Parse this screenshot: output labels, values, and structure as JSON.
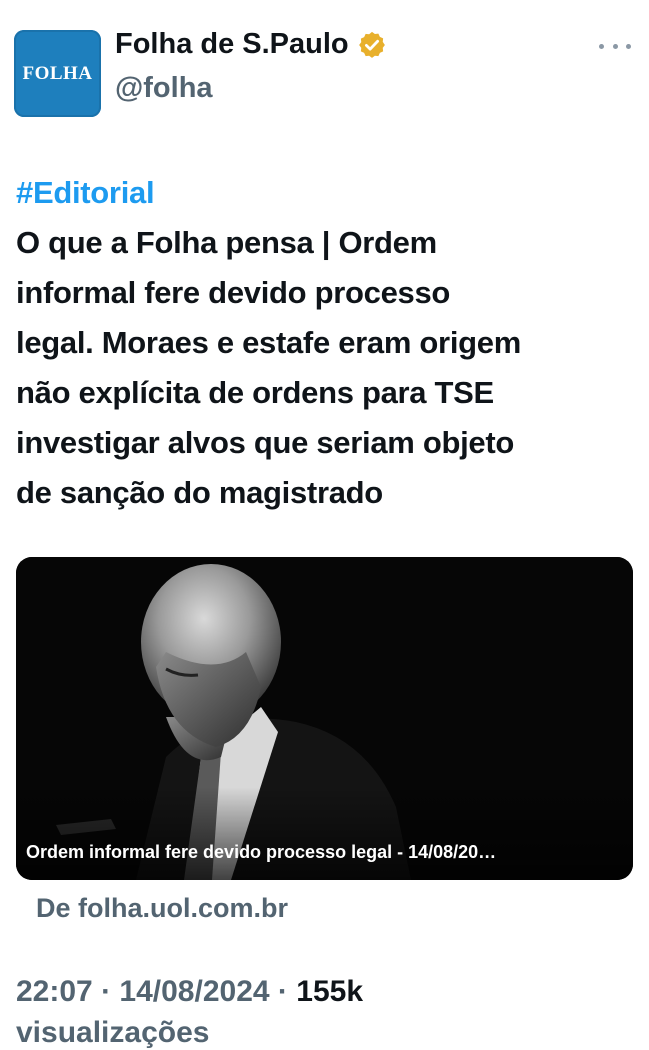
{
  "account": {
    "display_name": "Folha de S.Paulo",
    "handle": "@folha",
    "avatar_text": "FOLHA",
    "verified_badge_color": "#e8b02c",
    "avatar_color": "#1e7fbd"
  },
  "more_icon": "more-horizontal-icon",
  "tweet": {
    "hashtag": "#Editorial",
    "lines": [
      "O que a Folha pensa | Ordem",
      "informal fere devido processo",
      "legal. Moraes e estafe eram origem",
      "não explícita de ordens para TSE",
      "investigar alvos que seriam objeto",
      "de sanção do magistrado"
    ]
  },
  "link_card": {
    "caption": "Ordem informal fere devido processo legal - 14/08/20…",
    "source": "De folha.uol.com.br"
  },
  "meta": {
    "time": "22:07",
    "separator": "·",
    "date": "14/08/2024",
    "views": "155k",
    "views_label_partial": "visualizações"
  },
  "colors": {
    "link_blue": "#1d9bf0",
    "secondary_text": "#536471",
    "primary_text": "#0f1419"
  }
}
